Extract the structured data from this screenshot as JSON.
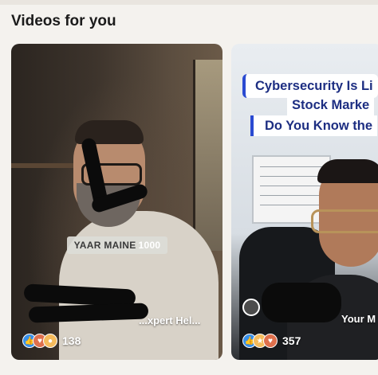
{
  "section": {
    "title": "Videos for you"
  },
  "videos": [
    {
      "caption": {
        "part1": "YAAR MAINE",
        "part2": "1000"
      },
      "title_visible": "...xpert Hel...",
      "reactions": {
        "icons": [
          "like-icon",
          "heart-icon",
          "insightful-icon"
        ],
        "count": "138"
      }
    },
    {
      "headline": {
        "line1": "Cybersecurity Is Li",
        "line2": "Stock Marke",
        "line3": "Do You Know the"
      },
      "title_visible": "Your M",
      "reactions": {
        "icons": [
          "like-icon",
          "celebrate-icon",
          "heart-icon"
        ],
        "count": "357"
      }
    }
  ],
  "colors": {
    "accent_blue": "#1d2e82",
    "like_blue": "#378fe9",
    "heart_orange": "#df704d",
    "insight_yellow": "#f5bb5c"
  }
}
